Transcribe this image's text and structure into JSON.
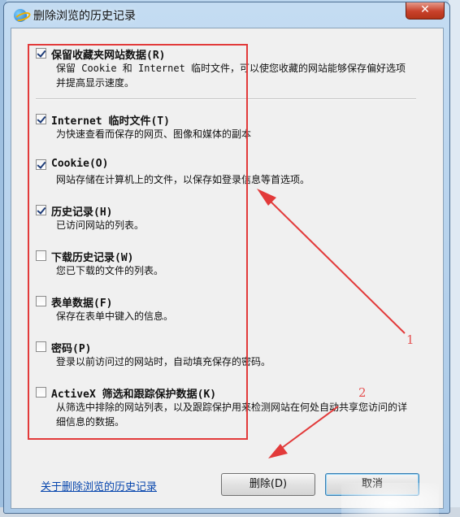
{
  "window": {
    "title": "删除浏览的历史记录",
    "close_label": "✕"
  },
  "items": [
    {
      "title": "保留收藏夹网站数据(R)",
      "desc": "保留 Cookie 和 Internet 临时文件，可以使您收藏的网站能够保存偏好选项并提高显示速度。",
      "checked": true
    },
    {
      "title": "Internet 临时文件(T)",
      "desc": "为快速查看而保存的网页、图像和媒体的副本",
      "checked": true
    },
    {
      "title": "Cookie(O)",
      "desc": "网站存储在计算机上的文件，以保存如登录信息等首选项。",
      "checked": true
    },
    {
      "title": "历史记录(H)",
      "desc": "已访问网站的列表。",
      "checked": true
    },
    {
      "title": "下载历史记录(W)",
      "desc": "您已下载的文件的列表。",
      "checked": false
    },
    {
      "title": "表单数据(F)",
      "desc": "保存在表单中键入的信息。",
      "checked": false
    },
    {
      "title": "密码(P)",
      "desc": "登录以前访问过的网站时，自动填充保存的密码。",
      "checked": false
    },
    {
      "title": "ActiveX 筛选和跟踪保护数据(K)",
      "desc": "从筛选中排除的网站列表，以及跟踪保护用来检测网站在何处自动共享您访问的详细信息的数据。",
      "checked": false
    }
  ],
  "footer": {
    "help_link": "关于删除浏览的历史记录",
    "delete_label": "删除(D)",
    "cancel_label": "取消"
  },
  "annotations": {
    "label_1": "1",
    "label_2": "2",
    "color": "#e23a3a"
  }
}
